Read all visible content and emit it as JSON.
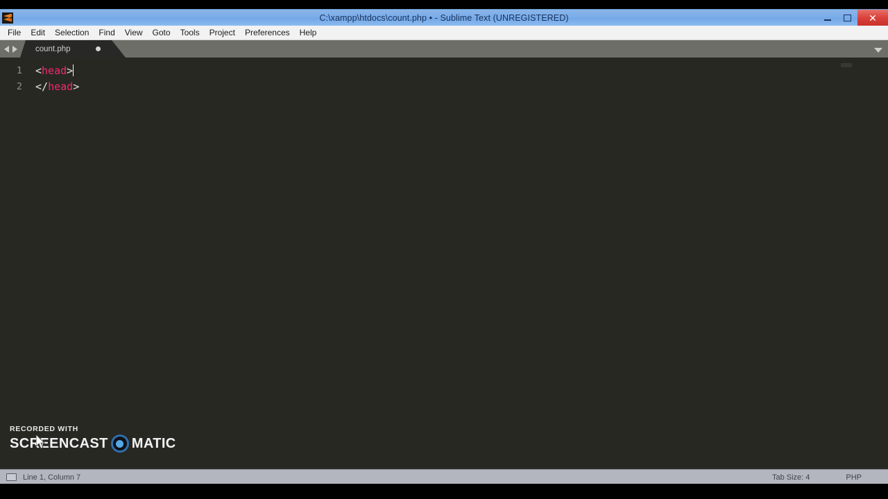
{
  "window": {
    "title": "C:\\xampp\\htdocs\\count.php • - Sublime Text (UNREGISTERED)",
    "app_icon": "sublime-text-icon",
    "controls": {
      "minimize": "–",
      "maximize": "❐",
      "close": "✕"
    }
  },
  "menubar": {
    "items": [
      {
        "label": "File"
      },
      {
        "label": "Edit"
      },
      {
        "label": "Selection"
      },
      {
        "label": "Find"
      },
      {
        "label": "View"
      },
      {
        "label": "Goto"
      },
      {
        "label": "Tools"
      },
      {
        "label": "Project"
      },
      {
        "label": "Preferences"
      },
      {
        "label": "Help"
      }
    ]
  },
  "tabbar": {
    "prev_icon": "chevron-left-icon",
    "next_icon": "chevron-right-icon",
    "menu_icon": "chevron-down-icon",
    "tabs": [
      {
        "label": "count.php",
        "dirty": true,
        "active": true
      }
    ]
  },
  "editor": {
    "gutter": [
      "1",
      "2"
    ],
    "lines": [
      {
        "number": "1",
        "tokens": [
          {
            "t": "punct",
            "v": "<"
          },
          {
            "t": "tag",
            "v": "head"
          },
          {
            "t": "punct",
            "v": ">"
          }
        ],
        "caret": true
      },
      {
        "number": "2",
        "tokens": [
          {
            "t": "punct",
            "v": "</"
          },
          {
            "t": "tag",
            "v": "head"
          },
          {
            "t": "punct",
            "v": ">"
          }
        ],
        "caret": false
      }
    ],
    "colors": {
      "background": "#272822",
      "tag": "#f92672",
      "punctuation": "#e4e4dc",
      "gutter_text": "#8f908a"
    }
  },
  "statusbar": {
    "icon": "monitor-icon",
    "caret_position": "Line 1, Column 7",
    "tab_size": "Tab Size: 4",
    "syntax": "PHP"
  },
  "watermark": {
    "line1": "RECORDED WITH",
    "word1": "SCREENCAST",
    "word2": "MATIC",
    "logo": "screencast-o-matic-logo",
    "ring_color": "#2f6fae",
    "dot_color": "#54a8e8"
  },
  "cursor": {
    "icon": "mouse-pointer-icon"
  }
}
